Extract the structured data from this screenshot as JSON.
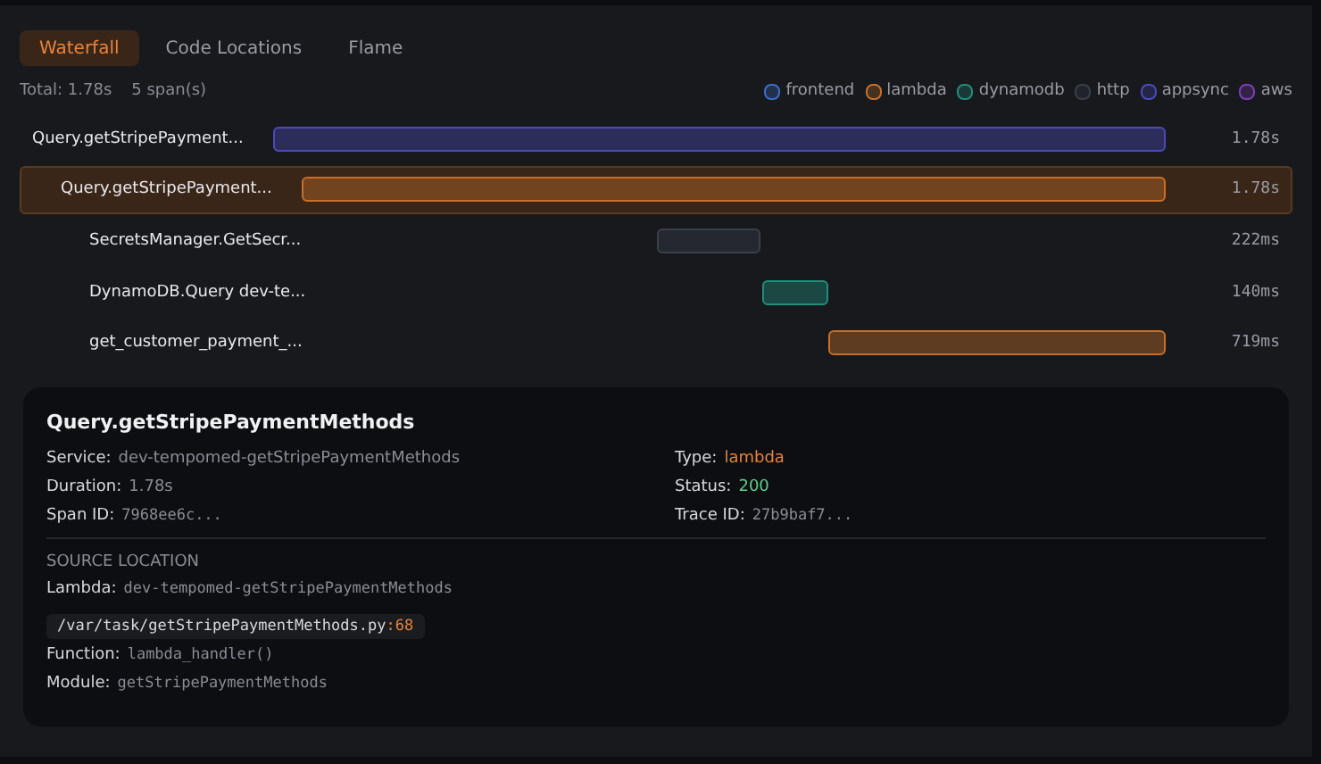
{
  "tabs": [
    {
      "label": "Waterfall",
      "selected": true
    },
    {
      "label": "Code Locations",
      "selected": false
    },
    {
      "label": "Flame",
      "selected": false
    }
  ],
  "summary": {
    "total": "Total: 1.78s",
    "spans": "5 span(s)"
  },
  "legend": [
    {
      "label": "frontend",
      "color": "#3b6fc9"
    },
    {
      "label": "lambda",
      "color": "#c8702a"
    },
    {
      "label": "dynamodb",
      "color": "#1f8f7a"
    },
    {
      "label": "http",
      "color": "#3a3f4b"
    },
    {
      "label": "appsync",
      "color": "#4a4bb8"
    },
    {
      "label": "aws",
      "color": "#7a3fb8"
    }
  ],
  "spans": [
    {
      "name": "Query.getStripePayment...",
      "color": "#4a4bb8",
      "duration": "1.78s",
      "selected": false,
      "children": [
        {
          "name": "Query.getStripePayment...",
          "color": "#c8702a",
          "duration": "1.78s",
          "selected": true,
          "children": [
            {
              "name": "SecretsManager.GetSecr...",
              "color": "#3a3f4b",
              "duration": "222ms",
              "selected": false
            },
            {
              "name": "DynamoDB.Query dev-te...",
              "color": "#1f8f7a",
              "duration": "140ms",
              "selected": false
            },
            {
              "name": "get_customer_payment_...",
              "color": "#c8702a",
              "duration": "719ms",
              "selected": false
            }
          ]
        }
      ]
    }
  ],
  "detail": {
    "title": "Query.getStripePaymentMethods",
    "fields_left": [
      {
        "label": "Service:",
        "value": "dev-tempomed-getStripePaymentMethods",
        "kind": "text"
      },
      {
        "label": "Duration:",
        "value": "1.78s",
        "kind": "text"
      },
      {
        "label": "Span ID:",
        "value": "7968ee6c...",
        "kind": "mono"
      }
    ],
    "fields_right": [
      {
        "label": "Type:",
        "value": "lambda",
        "kind": "type"
      },
      {
        "label": "Status:",
        "value": "200",
        "kind": "ok"
      },
      {
        "label": "Trace ID:",
        "value": "27b9baf7...",
        "kind": "mono"
      }
    ],
    "source": {
      "heading": "SOURCE LOCATION",
      "lambda_label": "Lambda:",
      "lambda": "dev-tempomed-getStripePaymentMethods",
      "path": "/var/task/getStripePaymentMethods.py",
      "line": ":68",
      "function_label": "Function:",
      "function": "lambda_handler()",
      "module_label": "Module:",
      "module": "getStripePaymentMethods"
    }
  }
}
